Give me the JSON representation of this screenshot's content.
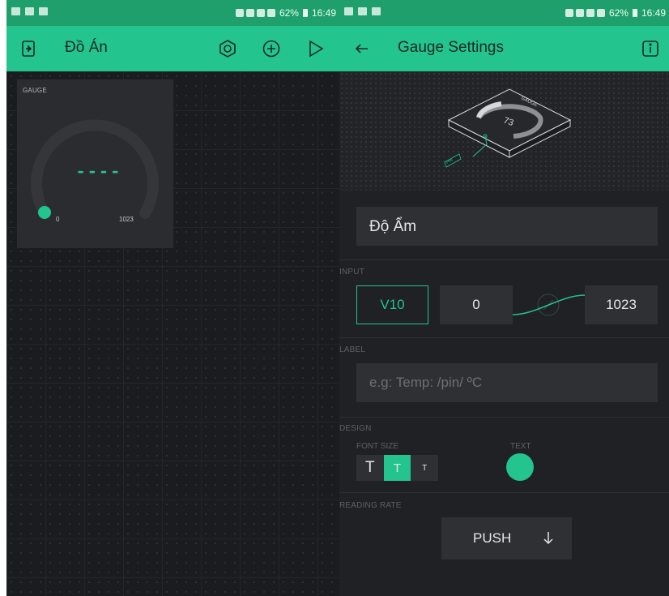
{
  "left_screen": {
    "status": {
      "time": "16:49",
      "battery": "62%"
    },
    "app_title": "Đồ Án",
    "toolbar": {
      "exit_icon": "exit-icon",
      "settings_icon": "hexagon-settings-icon",
      "add_icon": "plus-circle-icon",
      "play_icon": "play-icon"
    },
    "widget": {
      "type_label": "GAUGE",
      "min": "0",
      "max": "1023",
      "value": "----"
    }
  },
  "right_screen": {
    "status": {
      "time": "16:49",
      "battery": "62%"
    },
    "title": "Gauge Settings",
    "back_icon": "back-arrow-icon",
    "info_icon": "info-icon",
    "preview": {
      "gauge_text": "GAUGE",
      "value": "73",
      "pin_text": "PIN"
    },
    "name_value": "Độ Ẩm",
    "input": {
      "section": "INPUT",
      "pin": "V10",
      "min": "0",
      "max": "1023"
    },
    "label": {
      "section": "LABEL",
      "placeholder": "e.g: Temp: /pin/ ºC"
    },
    "design": {
      "section": "DESIGN",
      "font_size_caption": "FONT SIZE",
      "font_sizes": [
        "T",
        "T",
        "T"
      ],
      "selected_font_size": 1,
      "text_caption": "TEXT",
      "text_color": "#23c48e"
    },
    "reading_rate": {
      "section": "READING RATE",
      "value": "PUSH"
    }
  },
  "colors": {
    "accent": "#23c48e",
    "appbar": "#24c48e",
    "statusbar": "#1f9f6c",
    "background": "#1f2124"
  }
}
